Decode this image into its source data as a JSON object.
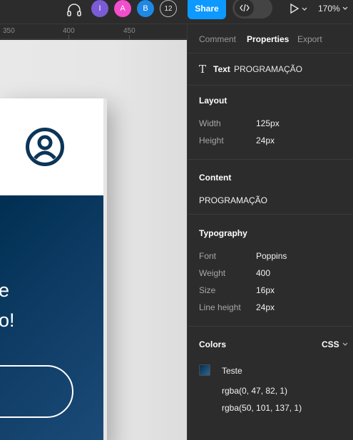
{
  "toolbar": {
    "headphones_icon": "headphones-icon",
    "avatars": [
      {
        "initial": "I",
        "color": "#7b5cd6"
      },
      {
        "initial": "A",
        "color": "#f24dcc"
      },
      {
        "initial": "B",
        "color": "#1e88e5"
      }
    ],
    "collaborator_count": "12",
    "share_label": "Share",
    "dev_mode_icon": "code-icon",
    "present_icon": "play-icon",
    "zoom_label": "170%"
  },
  "ruler": {
    "labels": [
      "350",
      "400",
      "450"
    ]
  },
  "canvas": {
    "hero_line_1": "e",
    "hero_line_2": "o!",
    "primary_color": "#002f52"
  },
  "panel": {
    "tabs": [
      "Comment",
      "Properties",
      "Export"
    ],
    "active_tab": "Properties",
    "selection": {
      "kind": "Text",
      "name": "PROGRAMAÇÃO"
    },
    "layout": {
      "title": "Layout",
      "rows": [
        {
          "label": "Width",
          "value": "125px"
        },
        {
          "label": "Height",
          "value": "24px"
        }
      ]
    },
    "content": {
      "title": "Content",
      "value": "PROGRAMAÇÃO"
    },
    "typography": {
      "title": "Typography",
      "rows": [
        {
          "label": "Font",
          "value": "Poppins"
        },
        {
          "label": "Weight",
          "value": "400"
        },
        {
          "label": "Size",
          "value": "16px"
        },
        {
          "label": "Line height",
          "value": "24px"
        }
      ]
    },
    "colors": {
      "title": "Colors",
      "format": "CSS",
      "style_name": "Teste",
      "values": [
        "rgba(0, 47, 82, 1)",
        "rgba(50, 101, 137, 1)"
      ]
    }
  }
}
